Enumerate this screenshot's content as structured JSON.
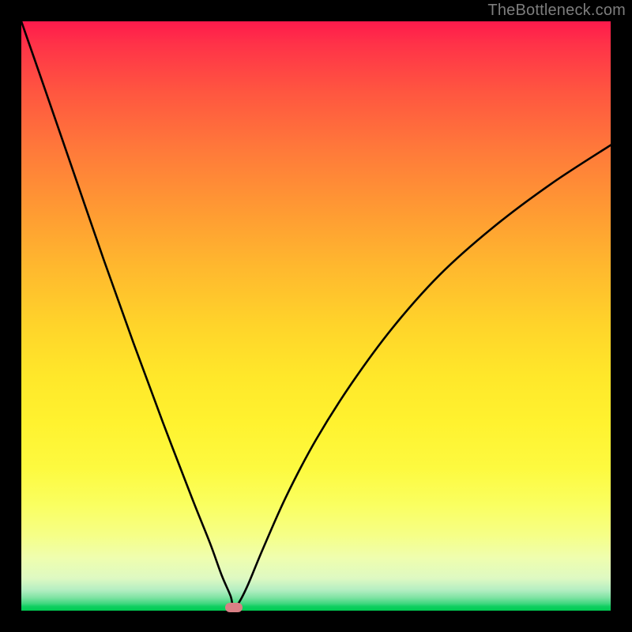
{
  "watermark": "TheBottleneck.com",
  "chart_data": {
    "type": "line",
    "title": "",
    "xlabel": "",
    "ylabel": "",
    "xlim": [
      0,
      100
    ],
    "ylim": [
      0,
      100
    ],
    "background_gradient": {
      "top_color": "#ff1a4c",
      "bottom_color": "#00cb52",
      "description": "Vertical gradient from red (high bottleneck) through orange/yellow to green (no bottleneck)."
    },
    "series": [
      {
        "name": "bottleneck-curve",
        "description": "V-shaped curve; left branch falls from top-left, minimum near x≈36, right branch rises toward upper-right.",
        "x": [
          0,
          4,
          9,
          14,
          19,
          24,
          29,
          32,
          34,
          35.5,
          36,
          37,
          38.5,
          41,
          45,
          50,
          56,
          63,
          71,
          80,
          90,
          100
        ],
        "y": [
          100,
          88.5,
          74,
          59.5,
          45.5,
          32,
          19,
          11.5,
          6,
          2.5,
          0.5,
          1.5,
          4.5,
          10.5,
          19.5,
          29,
          38.5,
          48,
          57,
          65,
          72.5,
          79
        ]
      }
    ],
    "marker": {
      "name": "optimal-point",
      "x": 36,
      "y": 0.5,
      "color": "#d98085"
    }
  }
}
